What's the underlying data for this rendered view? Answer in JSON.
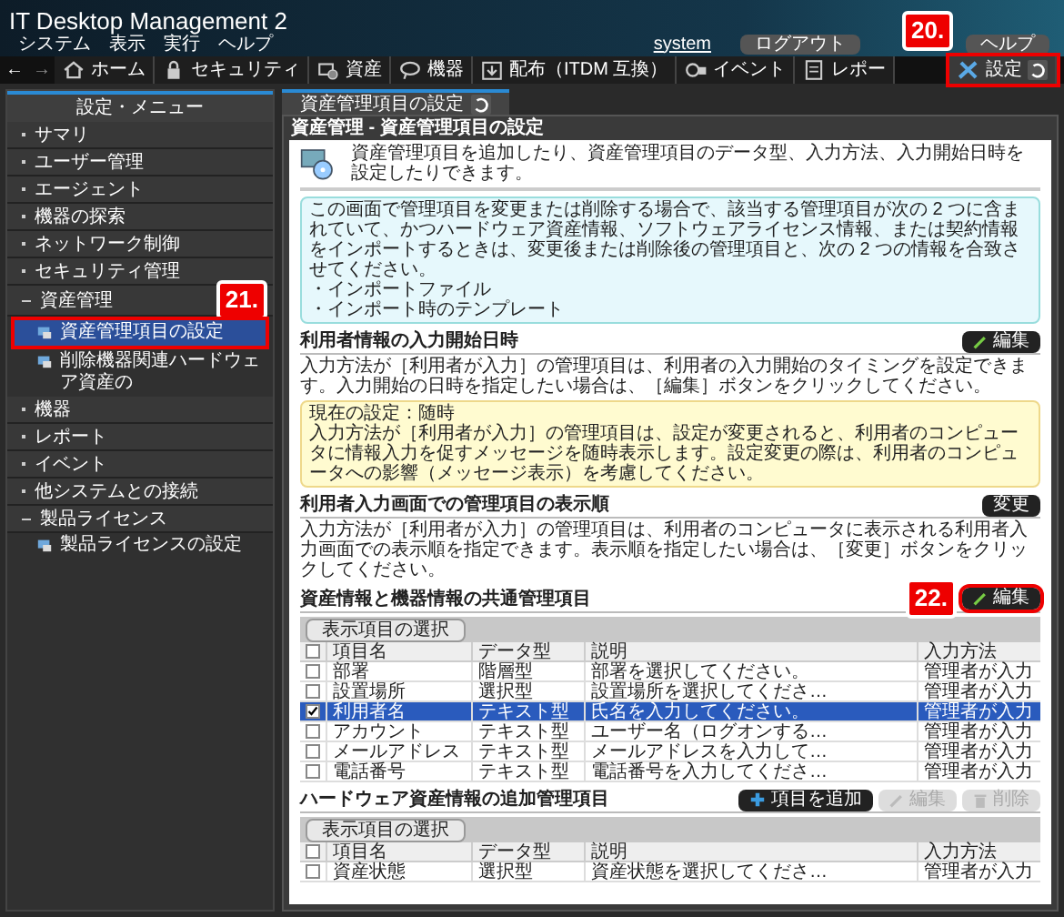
{
  "app": {
    "title": "IT Desktop Management 2",
    "menu": [
      "システム",
      "表示",
      "実行",
      "ヘルプ"
    ],
    "user": "system",
    "logout": "ログアウト",
    "help": "ヘルプ"
  },
  "nav": {
    "back": "←",
    "forward": "→",
    "tabs": [
      {
        "label": "ホーム",
        "selected": false
      },
      {
        "label": "セキュリティ",
        "selected": false
      },
      {
        "label": "資産",
        "selected": false
      },
      {
        "label": "機器",
        "selected": false
      },
      {
        "label": "配布（ITDM 互換）",
        "selected": false
      },
      {
        "label": "イベント",
        "selected": false
      },
      {
        "label": "レポー",
        "selected": false
      },
      {
        "label": "設定",
        "selected": true
      }
    ]
  },
  "sidebar": {
    "title": "設定・メニュー",
    "items": [
      {
        "label": "サマリ",
        "expanded": false
      },
      {
        "label": "ユーザー管理",
        "expanded": false
      },
      {
        "label": "エージェント",
        "expanded": false
      },
      {
        "label": "機器の探索",
        "expanded": false
      },
      {
        "label": "ネットワーク制御",
        "expanded": false
      },
      {
        "label": "セキュリティ管理",
        "expanded": false
      },
      {
        "label": "資産管理",
        "expanded": true,
        "children": [
          {
            "label": "資産管理項目の設定",
            "selected": true
          },
          {
            "label": "削除機器関連ハードウェア資産の",
            "selected": false
          }
        ]
      },
      {
        "label": "機器",
        "expanded": false
      },
      {
        "label": "レポート",
        "expanded": false
      },
      {
        "label": "イベント",
        "expanded": false
      },
      {
        "label": "他システムとの接続",
        "expanded": false
      },
      {
        "label": "製品ライセンス",
        "expanded": true,
        "children": [
          {
            "label": "製品ライセンスの設定",
            "selected": false
          }
        ]
      }
    ]
  },
  "page": {
    "tab": "資産管理項目の設定",
    "breadcrumb": "資産管理 - 資産管理項目の設定",
    "intro": "資産管理項目を追加したり、資産管理項目のデータ型、入力方法、入力開始日時を設定したりできます。",
    "notice": [
      "この画面で管理項目を変更または削除する場合で、該当する管理項目が次の 2 つに含まれていて、かつハードウェア資産情報、ソフトウェアライセンス情報、または契約情報をインポートするときは、変更後または削除後の管理項目と、次の 2 つの情報を合致させてください。",
      "・インポートファイル",
      "・インポート時のテンプレート"
    ],
    "sections": [
      {
        "title": "利用者情報の入力開始日時",
        "button": "編集",
        "button_icon": true,
        "text": "入力方法が［利用者が入力］の管理項目は、利用者の入力開始のタイミングを設定できます。入力開始の日時を指定したい場合は、［編集］ボタンをクリックしてください。",
        "current": {
          "title": "現在の設定：随時",
          "text": "入力方法が［利用者が入力］の管理項目は、設定が変更されると、利用者のコンピュータに情報入力を促すメッセージを随時表示します。設定変更の際は、利用者のコンピュータへの影響（メッセージ表示）を考慮してください。"
        }
      },
      {
        "title": "利用者入力画面での管理項目の表示順",
        "button": "変更",
        "button_icon": false,
        "text": "入力方法が［利用者が入力］の管理項目は、利用者のコンピュータに表示される利用者入力画面での表示順を指定できます。表示順を指定したい場合は、［変更］ボタンをクリックしてください。"
      }
    ],
    "tables": [
      {
        "title": "資産情報と機器情報の共通管理項目",
        "actions": [
          {
            "label": "編集",
            "kind": "edit",
            "disabled": false
          }
        ],
        "select_button": "表示項目の選択",
        "columns": [
          "項目名",
          "データ型",
          "説明",
          "入力方法"
        ],
        "all_checked": false,
        "rows": [
          {
            "cells": [
              "部署",
              "階層型",
              "部署を選択してください。",
              "管理者が入力"
            ],
            "checked": false,
            "selected": false
          },
          {
            "cells": [
              "設置場所",
              "選択型",
              "設置場所を選択してくださ…",
              "管理者が入力"
            ],
            "checked": false,
            "selected": false
          },
          {
            "cells": [
              "利用者名",
              "テキスト型",
              "氏名を入力してください。",
              "管理者が入力"
            ],
            "checked": true,
            "selected": true
          },
          {
            "cells": [
              "アカウント",
              "テキスト型",
              "ユーザー名（ログオンする…",
              "管理者が入力"
            ],
            "checked": false,
            "selected": false
          },
          {
            "cells": [
              "メールアドレス",
              "テキスト型",
              "メールアドレスを入力して…",
              "管理者が入力"
            ],
            "checked": false,
            "selected": false
          },
          {
            "cells": [
              "電話番号",
              "テキスト型",
              "電話番号を入力してくださ…",
              "管理者が入力"
            ],
            "checked": false,
            "selected": false
          }
        ]
      },
      {
        "title": "ハードウェア資産情報の追加管理項目",
        "actions": [
          {
            "label": "項目を追加",
            "kind": "add",
            "disabled": false
          },
          {
            "label": "編集",
            "kind": "edit",
            "disabled": true
          },
          {
            "label": "削除",
            "kind": "delete",
            "disabled": true
          }
        ],
        "select_button": "表示項目の選択",
        "columns": [
          "項目名",
          "データ型",
          "説明",
          "入力方法"
        ],
        "all_checked": false,
        "rows": [
          {
            "cells": [
              "資産状態",
              "選択型",
              "資産状態を選択してくださ…",
              "管理者が入力"
            ],
            "checked": false,
            "selected": false
          }
        ]
      }
    ]
  },
  "callouts": [
    "20.",
    "21.",
    "22."
  ]
}
